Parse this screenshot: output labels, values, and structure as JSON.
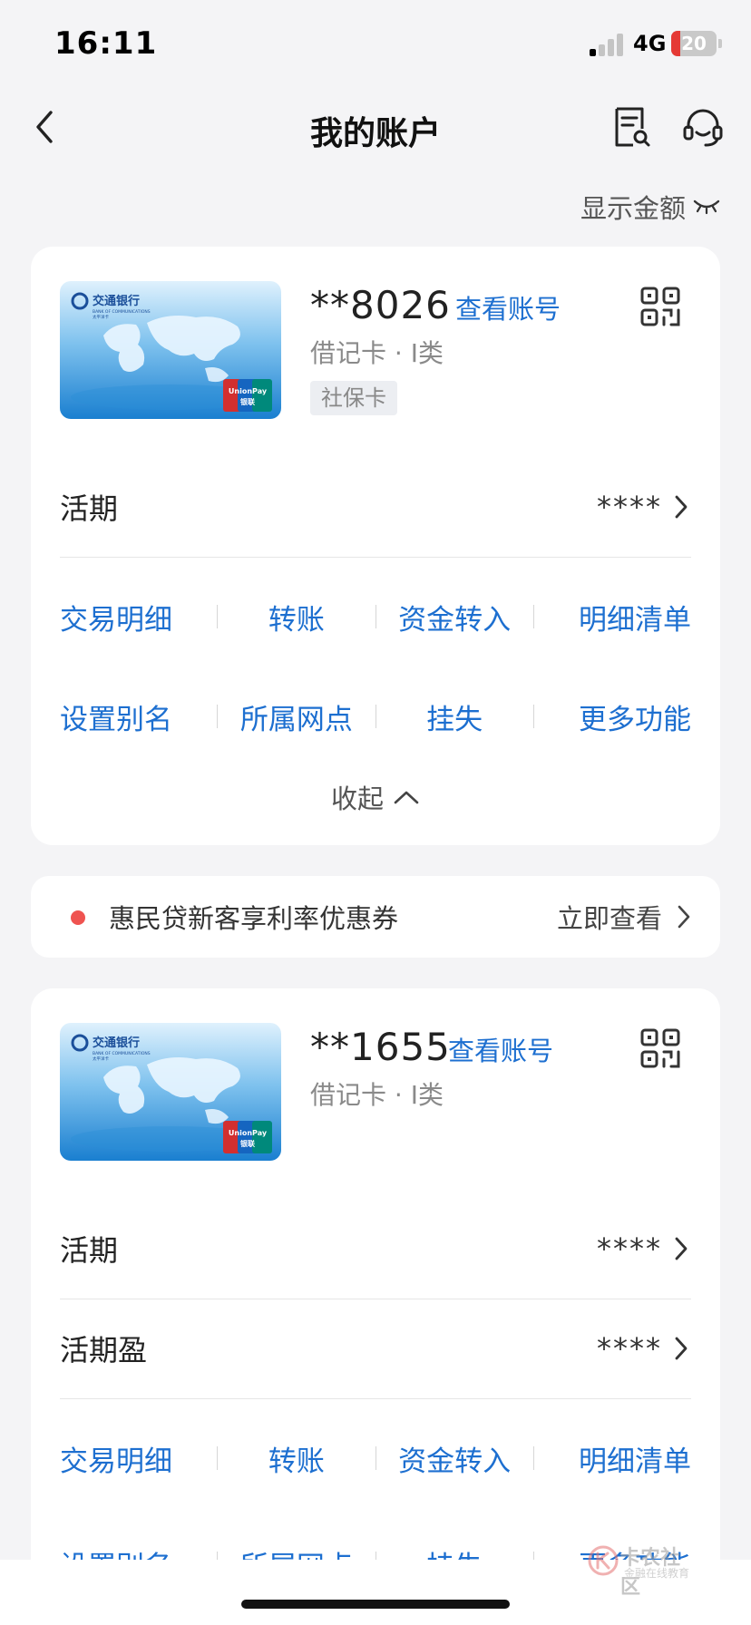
{
  "status_bar": {
    "time": "16:11",
    "network": "4G",
    "battery": "20",
    "battery_level": 0.2
  },
  "nav": {
    "title": "我的账户"
  },
  "show_amount_label": "显示金额",
  "cards": [
    {
      "account": "**8026",
      "view_account_label": "查看账号",
      "type": "借记卡 · Ⅰ类",
      "tag": "社保卡",
      "rows": [
        {
          "label": "活期",
          "masked": "****"
        }
      ],
      "actions": [
        [
          "交易明细",
          "转账",
          "资金转入",
          "明细清单"
        ],
        [
          "设置别名",
          "所属网点",
          "挂失",
          "更多功能"
        ]
      ],
      "collapse_label": "收起"
    },
    {
      "account": "**1655",
      "view_account_label": "查看账号",
      "type": "借记卡 · Ⅰ类",
      "rows": [
        {
          "label": "活期",
          "masked": "****"
        },
        {
          "label": "活期盈",
          "masked": "****"
        }
      ],
      "actions": [
        [
          "交易明细",
          "转账",
          "资金转入",
          "明细清单"
        ],
        [
          "设置别名",
          "所属网点",
          "挂失",
          "更多功能"
        ]
      ]
    }
  ],
  "bank_card_art": {
    "bank_name": "交通银行",
    "bank_name_en": "BANK OF COMMUNICATIONS",
    "card_sub": "太平洋卡",
    "unionpay": "UnionPay",
    "unionpay_cn": "银联"
  },
  "promo": {
    "text": "惠民贷新客享利率优惠券",
    "action": "立即查看"
  },
  "watermark": {
    "main": "卡农社区",
    "sub": "金融在线教育"
  },
  "colors": {
    "accent": "#1d6fd0",
    "promo_dot": "#ef5350",
    "background": "#f4f4f6"
  }
}
